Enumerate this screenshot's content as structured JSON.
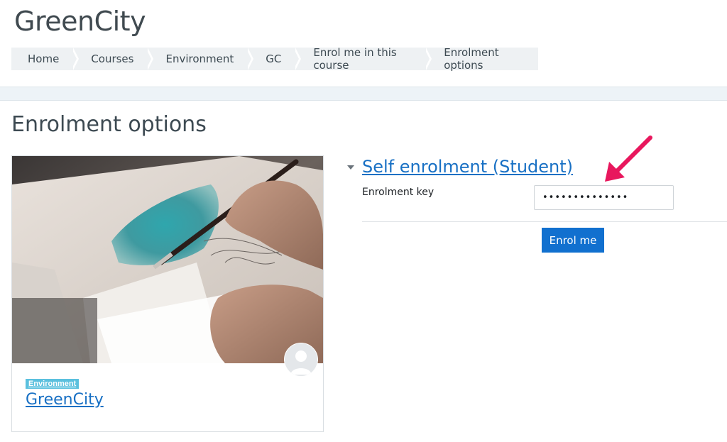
{
  "site": {
    "title": "GreenCity"
  },
  "breadcrumb": [
    {
      "label": "Home"
    },
    {
      "label": "Courses"
    },
    {
      "label": "Environment"
    },
    {
      "label": "GC"
    },
    {
      "label": "Enrol me in this course"
    },
    {
      "label": "Enrolment options"
    }
  ],
  "page": {
    "title": "Enrolment options"
  },
  "course": {
    "category_badge": "Environment",
    "name": "GreenCity",
    "image": "painting-watercolor-image",
    "avatar": "user-avatar-icon"
  },
  "enrolment": {
    "heading": "Self enrolment (Student)",
    "key_label": "Enrolment key",
    "key_value": "••••••••••••••",
    "submit_label": "Enrol me"
  },
  "colors": {
    "link": "#1870c4",
    "button": "#1170cf",
    "badge": "#5bc0de",
    "arrow": "#e8175d"
  }
}
